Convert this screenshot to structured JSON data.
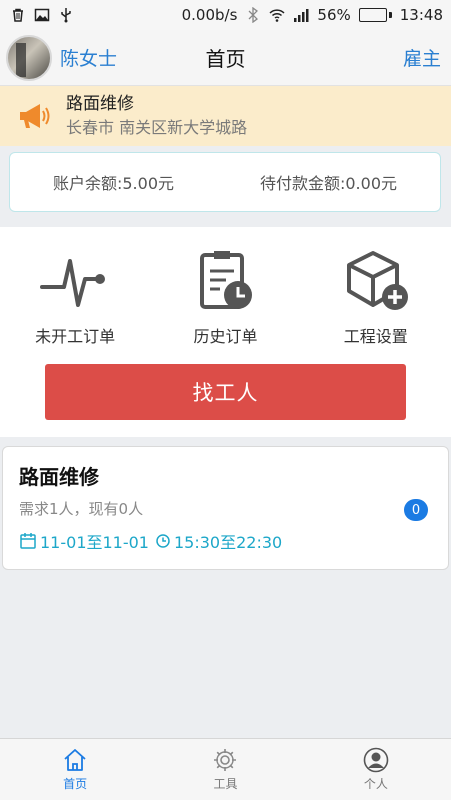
{
  "status_bar": {
    "network_speed": "0.00b/s",
    "battery_percent": "56%",
    "battery_level": 0.56,
    "time": "13:48",
    "icons": [
      "trash-icon",
      "image-icon",
      "usb-icon",
      "bluetooth-icon",
      "wifi-icon",
      "signal-icon",
      "battery-icon"
    ]
  },
  "header": {
    "user_name": "陈女士",
    "title": "首页",
    "role": "雇主"
  },
  "notice": {
    "title": "路面维修",
    "address": "长春市 南关区新大学城路",
    "icon": "megaphone-icon"
  },
  "balance": {
    "account_balance": "账户余额:5.00元",
    "pending_amount": "待付款金额:0.00元"
  },
  "menu": {
    "items": [
      {
        "label": "未开工订单",
        "icon": "pulse-icon"
      },
      {
        "label": "历史订单",
        "icon": "clipboard-clock-icon"
      },
      {
        "label": "工程设置",
        "icon": "box-plus-icon"
      }
    ],
    "find_worker": "找工人"
  },
  "order": {
    "title": "路面维修",
    "need": "需求1人，现有0人",
    "date_range": "11-01至11-01",
    "time_range": "15:30至22:30",
    "badge": "0"
  },
  "tabbar": {
    "tabs": [
      {
        "label": "首页",
        "icon": "home-icon",
        "active": true
      },
      {
        "label": "工具",
        "icon": "gear-icon",
        "active": false
      },
      {
        "label": "个人",
        "icon": "person-icon",
        "active": false
      }
    ]
  },
  "colors": {
    "accent": "#1b7be3",
    "link": "#2a7fd1",
    "button": "#dc4d48",
    "notice_bg": "#fbeccb",
    "schedule_text": "#1da7c9"
  }
}
